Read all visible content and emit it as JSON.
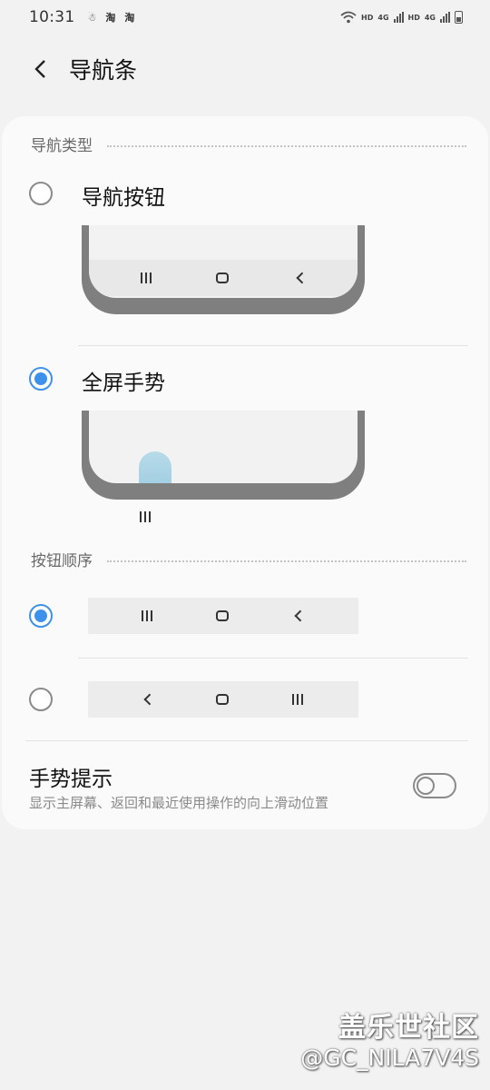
{
  "status_bar": {
    "time": "10:31",
    "app_icons": [
      "person-icon",
      "淘",
      "淘"
    ],
    "hd1": "HD",
    "net1": "4G",
    "hd2": "HD",
    "net2": "4G"
  },
  "header": {
    "title": "导航条"
  },
  "nav_type": {
    "section_title": "导航类型",
    "options": [
      {
        "label": "导航按钮",
        "selected": false
      },
      {
        "label": "全屏手势",
        "selected": true
      }
    ]
  },
  "button_order": {
    "section_title": "按钮顺序",
    "options": [
      {
        "order": [
          "recent",
          "home",
          "back"
        ],
        "selected": true
      },
      {
        "order": [
          "back",
          "home",
          "recent"
        ],
        "selected": false
      }
    ]
  },
  "gesture_hint": {
    "title": "手势提示",
    "description": "显示主屏幕、返回和最近使用操作的向上滑动位置",
    "enabled": false
  },
  "watermark": {
    "line1": "盖乐世社区",
    "line2": "@GC_NILA7V4S"
  },
  "colors": {
    "accent": "#3e91ea",
    "background": "#f2f2f2",
    "card": "#fafafa"
  }
}
